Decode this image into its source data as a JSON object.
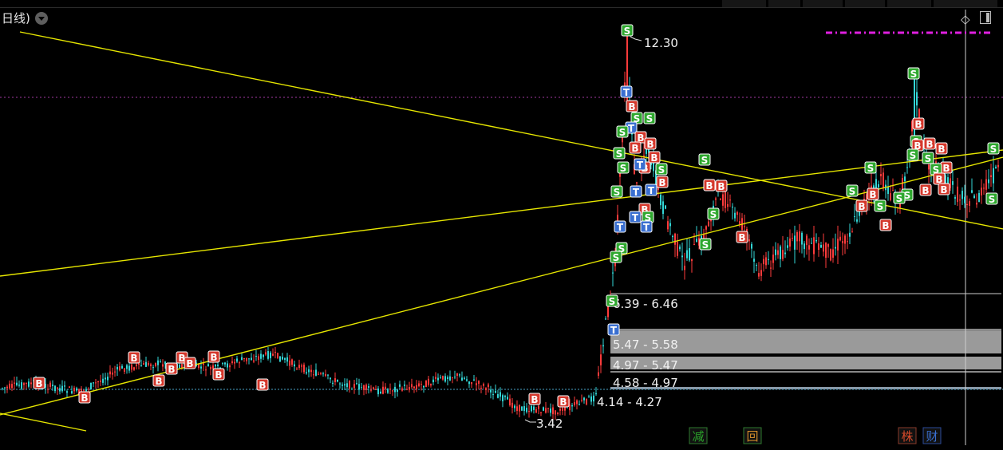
{
  "header": {
    "period_label": "日线)",
    "diamond": "◇"
  },
  "colors": {
    "background": "#000000",
    "trendline": "#e6e600",
    "resistance": "#cc33cc",
    "up": "#ff3b3b",
    "down": "#33d6d6",
    "buy": "#d4382c",
    "sell": "#2fa82f",
    "t_signal": "#3a6fd0",
    "volume_profile": "#8f8f8f"
  },
  "chart_data": {
    "type": "candlestick",
    "price_high_label": "12.30",
    "price_low_label": "3.42",
    "price_range": [
      3.2,
      12.8
    ],
    "volume_profile": [
      {
        "label": "6.39 - 6.46",
        "low": 6.39,
        "high": 6.46
      },
      {
        "label": "5.47 - 5.58",
        "low": 5.47,
        "high": 5.58
      },
      {
        "label": "4.97 - 5.47",
        "low": 4.97,
        "high": 5.47
      },
      {
        "label": "4.58 - 4.97",
        "low": 4.58,
        "high": 4.97
      },
      {
        "label": "4.14 - 4.27",
        "low": 4.14,
        "high": 4.27
      }
    ],
    "signal_labels": {
      "buy": "B",
      "sell": "S",
      "t": "T"
    },
    "bottom_markers": [
      "减",
      "回",
      "株",
      "财"
    ],
    "resistance_line": "dashed magenta",
    "trendlines": 4
  }
}
